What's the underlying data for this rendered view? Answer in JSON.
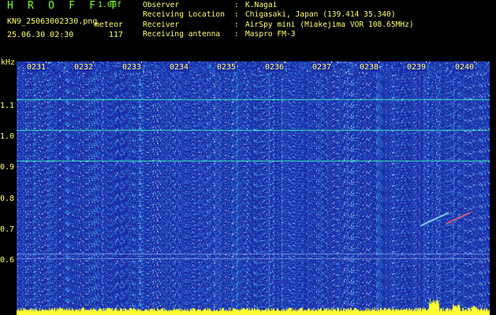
{
  "header": {
    "title": "H R O F F T",
    "version": "1.00f",
    "filename": "KN9_25063002330.png",
    "datetime": "25.06.30 02:30",
    "mode": "meteor",
    "count": "117"
  },
  "station_info": [
    {
      "key": "Observer",
      "sep": ":",
      "value": "K.Nagai"
    },
    {
      "key": "Receiving Location",
      "sep": ":",
      "value": "Chigasaki, Japan (139.414 35.340)"
    },
    {
      "key": "Receiver",
      "sep": ":",
      "value": "AirSpy mini (Miakejima VOR 108.65MHz)"
    },
    {
      "key": "Receiving antenna",
      "sep": ":",
      "value": "Maspro FM-3"
    }
  ],
  "spectrogram": {
    "freq_unit": "kHz",
    "freq_labels": [
      "1.1",
      "1.0",
      "0.9",
      "0.8",
      "0.7",
      "0.6"
    ],
    "time_labels": [
      "0231",
      "0232",
      "0233",
      "0234",
      "0235",
      "0236",
      "0237",
      "0238",
      "0239",
      "0240"
    ],
    "colors": {
      "background": "#1b2ea8",
      "noise": "#2e8fe6",
      "carrier": "#3de8c0",
      "signal": "#ffff33",
      "text": "#ffff66",
      "title": "#7cff1a"
    }
  }
}
